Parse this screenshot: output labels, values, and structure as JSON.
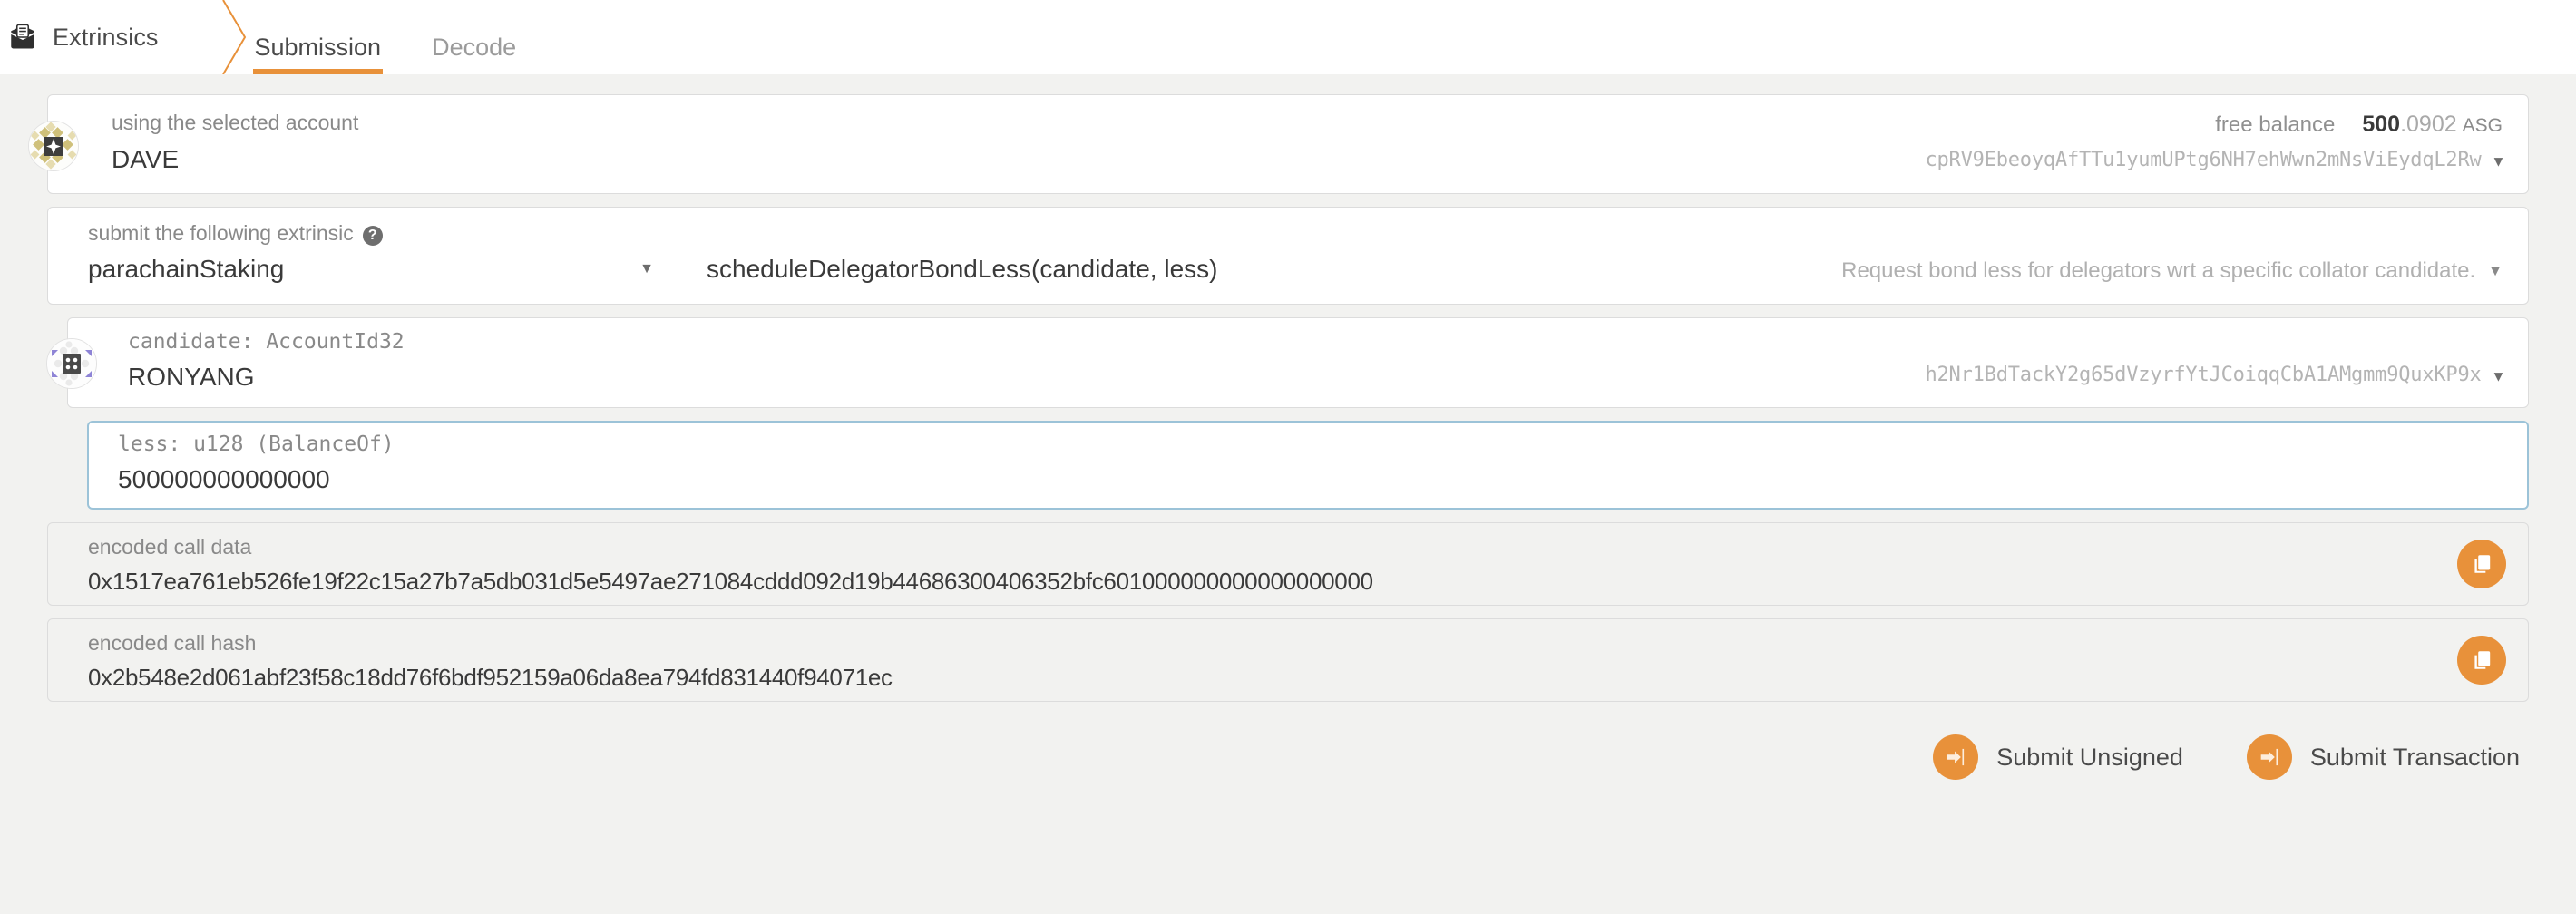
{
  "header": {
    "app_icon": "extrinsics-icon",
    "title": "Extrinsics",
    "tabs": [
      {
        "label": "Submission",
        "active": true
      },
      {
        "label": "Decode",
        "active": false
      }
    ]
  },
  "account": {
    "label": "using the selected account",
    "name": "DAVE",
    "balance_label": "free balance",
    "balance_int": "500",
    "balance_frac": ".0902",
    "balance_unit": "ASG",
    "address": "cpRV9EbeoyqAfTTu1yumUPtg6NH7ehWwn2mNsViEydqL2Rw",
    "dropdown_icon": "chevron-down-icon"
  },
  "extrinsic": {
    "label": "submit the following extrinsic",
    "help_icon": "help-circle-icon",
    "module": "parachainStaking",
    "method": "scheduleDelegatorBondLess(candidate, less)",
    "description": "Request bond less for delegators wrt a specific collator candidate.",
    "dropdown_icon": "chevron-down-icon"
  },
  "params": [
    {
      "label": "candidate: AccountId32",
      "name": "RONYANG",
      "address": "h2Nr1BdTackY2g65dVzyrfYtJCoiqqCbA1AMgmm9QuxKP9x",
      "dropdown_icon": "chevron-down-icon"
    },
    {
      "label": "less: u128 (BalanceOf)",
      "value": "500000000000000"
    }
  ],
  "encoded": [
    {
      "label": "encoded call data",
      "value": "0x1517ea761eb526fe19f22c15a27b7a5db031d5e5497ae271084cddd092d19b44686300406352bfc601000000000000000000",
      "copy_icon": "copy-icon"
    },
    {
      "label": "encoded call hash",
      "value": "0x2b548e2d061abf23f58c18dd76f6bdf952159a06da8ea794fd831440f94071ec",
      "copy_icon": "copy-icon"
    }
  ],
  "footer": {
    "buttons": [
      {
        "label": "Submit Unsigned",
        "icon": "sign-in-icon"
      },
      {
        "label": "Submit Transaction",
        "icon": "sign-in-icon"
      }
    ]
  },
  "colors": {
    "accent": "#e8913a",
    "page_bg": "#f2f2f0",
    "card_bg": "#ffffff",
    "border": "#dcdcdc",
    "focus_border": "#9cc3d8",
    "text": "#3a3a3a",
    "muted": "#b0b0b0"
  }
}
